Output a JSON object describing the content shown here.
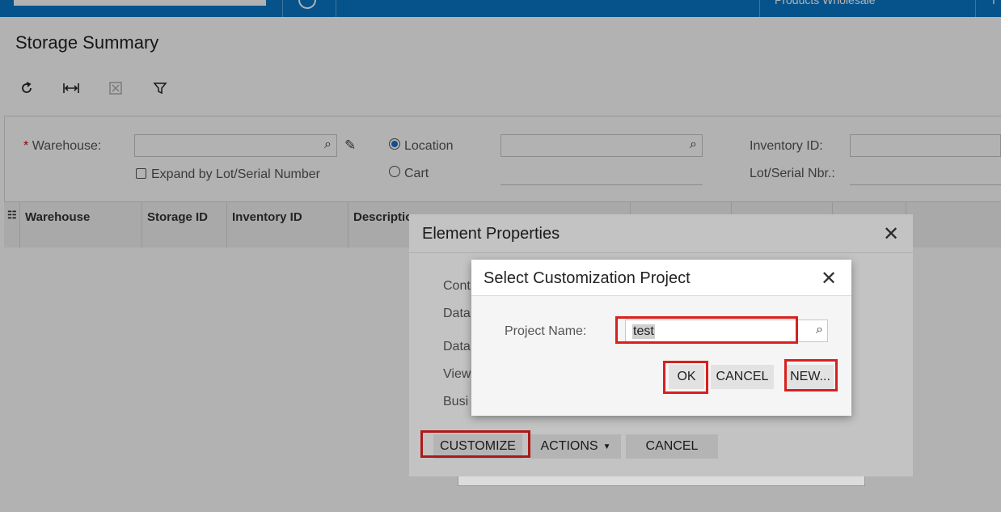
{
  "topbar": {
    "branch": "Products Wholesale",
    "more": "I"
  },
  "page": {
    "title": "Storage Summary"
  },
  "toolbar": {
    "refresh_icon": "refresh-icon",
    "fit_icon": "fit-columns-icon",
    "export_icon": "excel-export-icon",
    "filter_icon": "filter-icon"
  },
  "filter": {
    "warehouse_label": "Warehouse:",
    "required_mark": "*",
    "expand_label": "Expand by Lot/Serial Number",
    "location_label": "Location",
    "cart_label": "Cart",
    "inventory_label": "Inventory ID:",
    "lot_label": "Lot/Serial Nbr.:"
  },
  "grid": {
    "columns": [
      "Warehouse",
      "Storage ID",
      "Inventory ID",
      "Description"
    ]
  },
  "element_properties": {
    "title": "Element Properties",
    "rows": [
      "Cont",
      "Data",
      "Data",
      "View",
      "Busi"
    ],
    "buttons": {
      "customize": "CUSTOMIZE",
      "actions": "ACTIONS",
      "cancel": "CANCEL"
    }
  },
  "select_project": {
    "title": "Select Customization Project",
    "project_label": "Project Name:",
    "project_value": "test",
    "buttons": {
      "ok": "OK",
      "cancel": "CANCEL",
      "new": "NEW..."
    }
  }
}
